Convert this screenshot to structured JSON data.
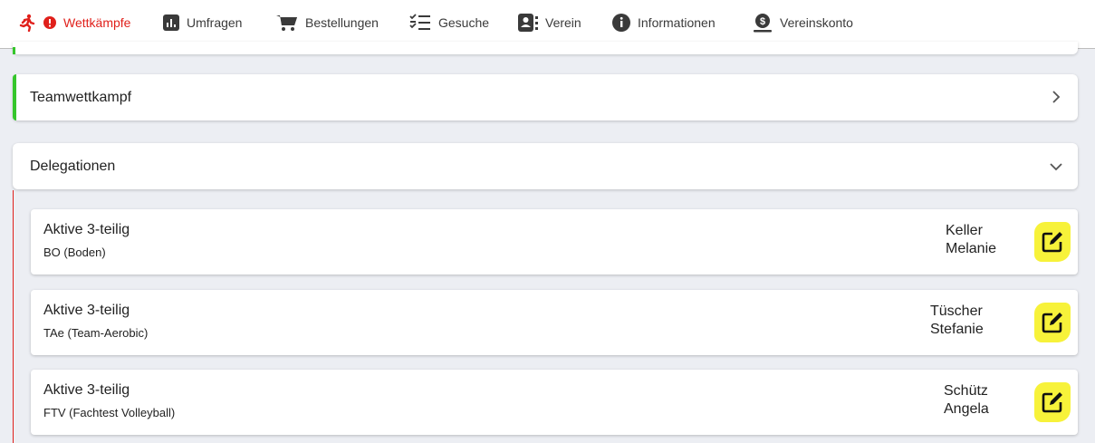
{
  "nav": {
    "items": [
      {
        "label": "Wettkämpfe",
        "icon": "runner-icon",
        "active": true
      },
      {
        "label": "Umfragen",
        "icon": "bar-chart-icon"
      },
      {
        "label": "Bestellungen",
        "icon": "cart-icon"
      },
      {
        "label": "Gesuche",
        "icon": "checklist-icon"
      },
      {
        "label": "Verein",
        "icon": "contact-book-icon"
      },
      {
        "label": "Informationen",
        "icon": "info-icon"
      },
      {
        "label": "Vereinskonto",
        "icon": "money-icon"
      }
    ],
    "alert_icon": "exclamation-icon"
  },
  "panels": {
    "team": {
      "title": "Teamwettkampf",
      "icon": "chevron-right-icon"
    },
    "delegations": {
      "title": "Delegationen",
      "icon": "chevron-down-icon"
    }
  },
  "delegations": [
    {
      "category": "Aktive 3-teilig",
      "discipline": "BO (Boden)",
      "last_name": "Keller",
      "first_name": "Melanie"
    },
    {
      "category": "Aktive 3-teilig",
      "discipline": "TAe (Team-Aerobic)",
      "last_name": "Tüscher",
      "first_name": "Stefanie"
    },
    {
      "category": "Aktive 3-teilig",
      "discipline": "FTV (Fachtest Volleyball)",
      "last_name": "Schütz",
      "first_name": "Angela"
    }
  ],
  "colors": {
    "accent_red": "#e0201b",
    "accent_green": "#35c62b",
    "highlight_yellow": "#f7f23a"
  }
}
